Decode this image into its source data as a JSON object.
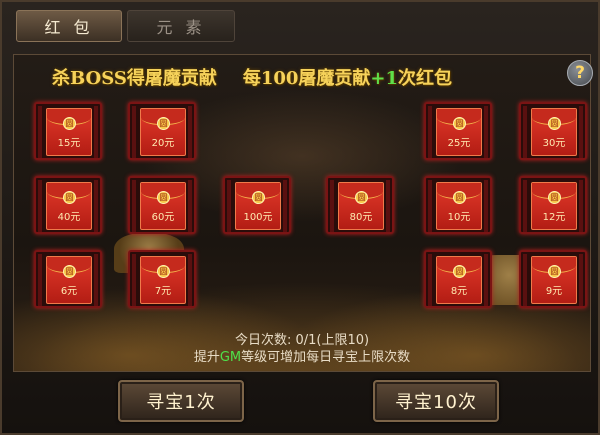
{
  "tabs": [
    {
      "label": "红 包",
      "active": true
    },
    {
      "label": "元 素",
      "active": false
    }
  ],
  "headline": {
    "part1": "杀BOSS得屠魔贡献",
    "part2": "每100屠魔贡献",
    "part3": "+1",
    "part4": "次红包"
  },
  "help_icon": "question-mark-icon",
  "envelopes": [
    {
      "amount": "15元"
    },
    {
      "amount": "20元"
    },
    {
      "amount": "25元"
    },
    {
      "amount": "30元"
    },
    {
      "amount": "40元"
    },
    {
      "amount": "60元"
    },
    {
      "amount": "100元"
    },
    {
      "amount": "80元"
    },
    {
      "amount": "10元"
    },
    {
      "amount": "12元"
    },
    {
      "amount": "6元"
    },
    {
      "amount": "7元"
    },
    {
      "amount": "8元"
    },
    {
      "amount": "9元"
    }
  ],
  "seal_glyph": "圆",
  "status": {
    "daily_count_label": "今日次数: 0/1(上限10)",
    "upgrade_prefix": "提升",
    "upgrade_gm": "GM",
    "upgrade_suffix": "等级可增加每日寻宝上限次数"
  },
  "buttons": {
    "once": "寻宝1次",
    "ten": "寻宝10次"
  },
  "colors": {
    "headline_gold": "#f6d25a",
    "headline_green": "#5fe04a",
    "envelope_red": "#e2392a",
    "gm_green": "#4fe04a"
  }
}
